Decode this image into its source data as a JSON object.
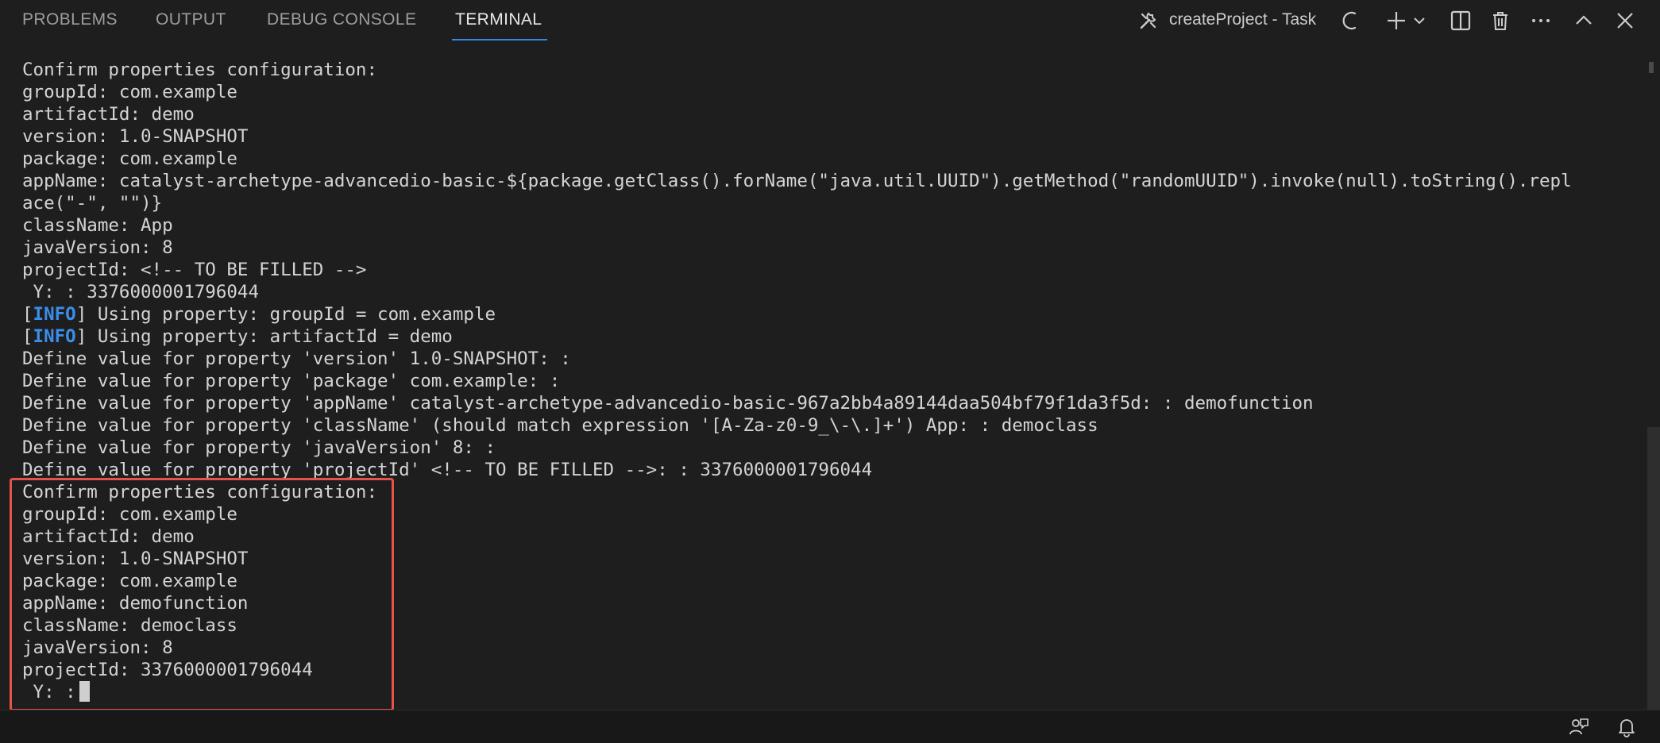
{
  "tabs": [
    {
      "label": "PROBLEMS"
    },
    {
      "label": "OUTPUT"
    },
    {
      "label": "DEBUG CONSOLE"
    },
    {
      "label": "TERMINAL",
      "active": true
    }
  ],
  "task": {
    "title": "createProject - Task",
    "icon": "tools-icon",
    "status_icon": "loading-spinner-icon"
  },
  "toolbar": {
    "icons": [
      "add-icon",
      "chevron-down-icon",
      "split-icon",
      "trash-icon",
      "more-icon",
      "chevron-up-icon",
      "close-icon"
    ]
  },
  "terminal": {
    "lines": [
      "Confirm properties configuration:",
      "groupId: com.example",
      "artifactId: demo",
      "version: 1.0-SNAPSHOT",
      "package: com.example",
      "appName: catalyst-archetype-advancedio-basic-${package.getClass().forName(\"java.util.UUID\").getMethod(\"randomUUID\").invoke(null).toString().repl",
      "ace(\"-\", \"\")}",
      "className: App",
      "javaVersion: 8",
      "projectId: <!-- TO BE FILLED -->",
      " Y: : 3376000001796044",
      "] Using property: groupId = com.example",
      "] Using property: artifactId = demo",
      "Define value for property 'version' 1.0-SNAPSHOT: :",
      "Define value for property 'package' com.example: :",
      "Define value for property 'appName' catalyst-archetype-advancedio-basic-967a2bb4a89144daa504bf79f1da3f5d: : demofunction",
      "Define value for property 'className' (should match expression '[A-Za-z0-9_\\-\\.]+') App: : democlass",
      "Define value for property 'javaVersion' 8: :",
      "Define value for property 'projectId' <!-- TO BE FILLED -->: : 3376000001796044",
      "Confirm properties configuration:",
      "groupId: com.example",
      "artifactId: demo",
      "version: 1.0-SNAPSHOT",
      "package: com.example",
      "appName: demofunction",
      "className: democlass",
      "javaVersion: 8",
      "projectId: 3376000001796044",
      " Y: :"
    ],
    "info_prefix": "[",
    "info_tag": "INFO"
  },
  "status": {
    "icons": [
      "feedback-icon",
      "bell-icon"
    ]
  },
  "colors": {
    "background": "#1e1e1e",
    "text": "#d4d4d4",
    "info": "#3b8eea",
    "highlight": "#e5534b",
    "tab_accent": "#2f8ae8"
  }
}
